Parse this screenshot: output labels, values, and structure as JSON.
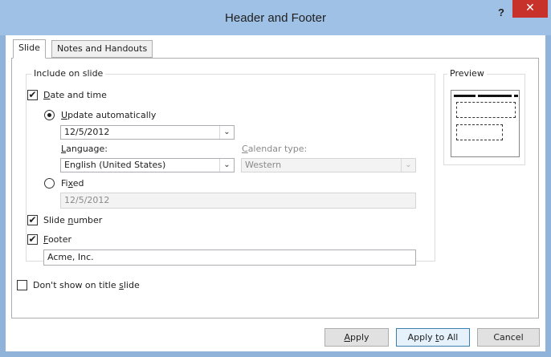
{
  "dialog": {
    "title": "Header and Footer",
    "help_label": "?",
    "close_label": "✕"
  },
  "tabs": [
    {
      "label": "Slide",
      "active": true
    },
    {
      "label": "Notes and Handouts",
      "active": false
    }
  ],
  "include_group": {
    "label": "Include on slide",
    "date_time": {
      "label_underline": "D",
      "label_rest": "ate and time",
      "checked": true
    },
    "update_auto": {
      "label_underline": "U",
      "label_rest": "pdate automatically",
      "selected": true
    },
    "date_combo": {
      "value": "12/5/2012"
    },
    "language": {
      "label_underline": "L",
      "label_rest": "anguage:",
      "value": "English (United States)"
    },
    "calendar": {
      "label_underline": "C",
      "label_rest": "alendar type:",
      "value": "Western"
    },
    "fixed": {
      "label_pre": "Fi",
      "label_underline": "x",
      "label_rest": "ed",
      "selected": false,
      "value": "12/5/2012"
    },
    "slide_number": {
      "label_pre": "Slide ",
      "label_underline": "n",
      "label_rest": "umber",
      "checked": true
    },
    "footer": {
      "label_underline": "F",
      "label_rest": "ooter",
      "checked": true,
      "value": "Acme, Inc."
    }
  },
  "dont_show": {
    "label_pre": "Don't show on title ",
    "label_underline": "s",
    "label_rest": "lide",
    "checked": false
  },
  "preview": {
    "label": "Preview"
  },
  "buttons": {
    "apply_underline": "A",
    "apply_rest": "pply",
    "apply_all_pre": "Apply ",
    "apply_all_underline": "t",
    "apply_all_rest": "o All",
    "cancel": "Cancel"
  },
  "icons": {
    "checkmark": "✔",
    "dropdown": "⌄"
  },
  "colors": {
    "titlebar": "#9fc1e6",
    "close": "#c7332b",
    "default_button": "#e5f1fb"
  }
}
